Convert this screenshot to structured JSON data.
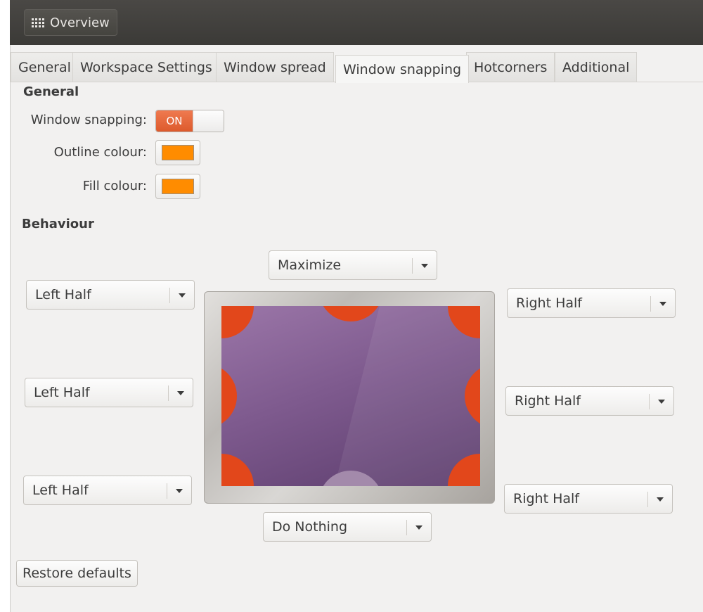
{
  "header": {
    "overview_label": "Overview"
  },
  "tabs": [
    {
      "label": "General"
    },
    {
      "label": "Workspace Settings"
    },
    {
      "label": "Window spread"
    },
    {
      "label": "Window snapping",
      "active": true
    },
    {
      "label": "Hotcorners"
    },
    {
      "label": "Additional"
    }
  ],
  "general": {
    "title": "General",
    "window_snapping_label": "Window snapping:",
    "window_snapping_state": "ON",
    "outline_colour_label": "Outline colour:",
    "outline_colour": "#ff8c00",
    "fill_colour_label": "Fill colour:",
    "fill_colour": "#ff8c00"
  },
  "behaviour": {
    "title": "Behaviour",
    "top": "Maximize",
    "bottom": "Do Nothing",
    "left_top": "Left Half",
    "left_middle": "Left Half",
    "left_bottom": "Left Half",
    "right_top": "Right Half",
    "right_middle": "Right Half",
    "right_bottom": "Right Half"
  },
  "colors": {
    "accent": "#e2471b",
    "screen_purple": "#7e5a8e"
  },
  "footer": {
    "restore_label": "Restore defaults"
  }
}
